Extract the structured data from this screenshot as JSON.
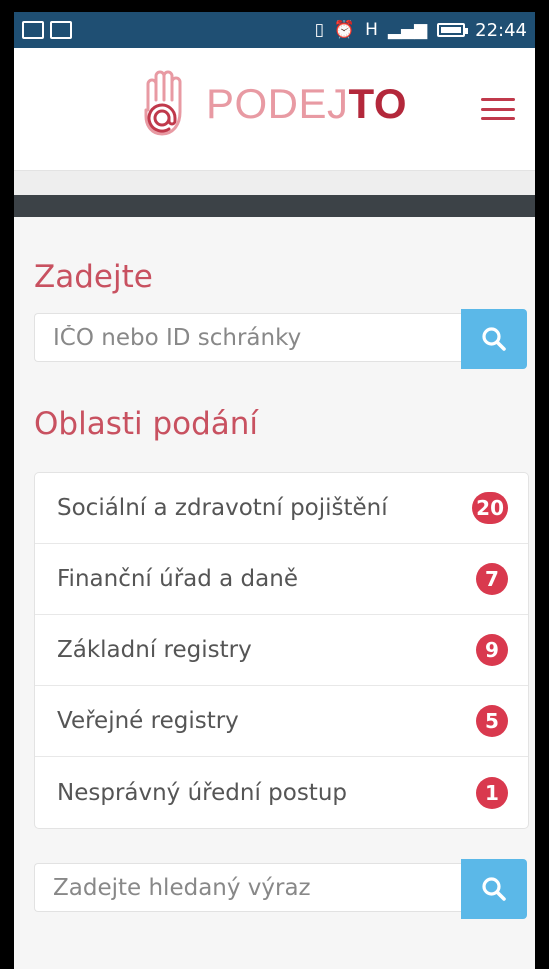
{
  "statusbar": {
    "time": "22:44",
    "network_label": "H"
  },
  "header": {
    "logo_prefix": "PODEJ",
    "logo_suffix": "TO",
    "brand_color": "#c85160"
  },
  "search": {
    "heading": "Zadejte",
    "placeholder": "IČO nebo ID schránky",
    "button_icon": "search-icon"
  },
  "areas": {
    "heading": "Oblasti podání",
    "items": [
      {
        "label": "Sociální a zdravotní pojištění",
        "count": "20"
      },
      {
        "label": "Finanční úřad a daně",
        "count": "7"
      },
      {
        "label": "Základní registry",
        "count": "9"
      },
      {
        "label": "Veřejné registry",
        "count": "5"
      },
      {
        "label": "Nesprávný úřední postup",
        "count": "1"
      }
    ]
  },
  "bottom_search": {
    "placeholder": "Zadejte hledaný výraz",
    "button_icon": "search-icon"
  },
  "colors": {
    "accent": "#5bb8e8",
    "badge": "#d9394e",
    "statusbar": "#1f4f73"
  }
}
